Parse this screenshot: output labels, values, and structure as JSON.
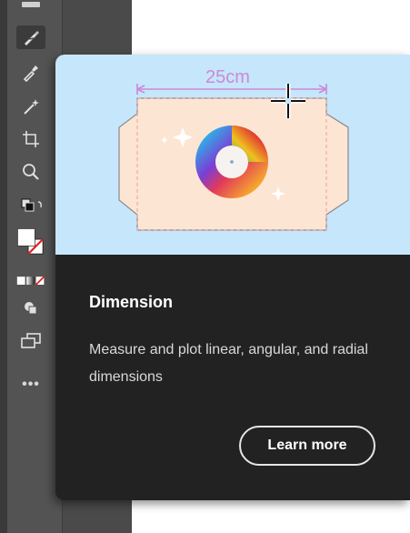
{
  "toolbar": {
    "tools": [
      {
        "icon": "pen-tool-icon"
      },
      {
        "icon": "eyedropper-icon"
      },
      {
        "icon": "magic-wand-icon"
      },
      {
        "icon": "crop-icon"
      },
      {
        "icon": "zoom-icon"
      },
      {
        "icon": "default-colors-icon"
      },
      {
        "icon": "fill-stroke-icon"
      },
      {
        "icon": "color-mode-icon"
      },
      {
        "icon": "draw-mode-icon"
      },
      {
        "icon": "screen-mode-icon"
      }
    ],
    "more_label": "•••"
  },
  "tooltip_card": {
    "illustration_label": "25cm",
    "title": "Dimension",
    "description": "Measure and plot linear, angular, and radial dimensions",
    "learn_more_label": "Learn more"
  },
  "colors": {
    "toolbar_bg": "#535353",
    "card_bg": "#222222",
    "illustration_bg": "#c6e6fb",
    "dimension_accent": "#c98ad7"
  }
}
